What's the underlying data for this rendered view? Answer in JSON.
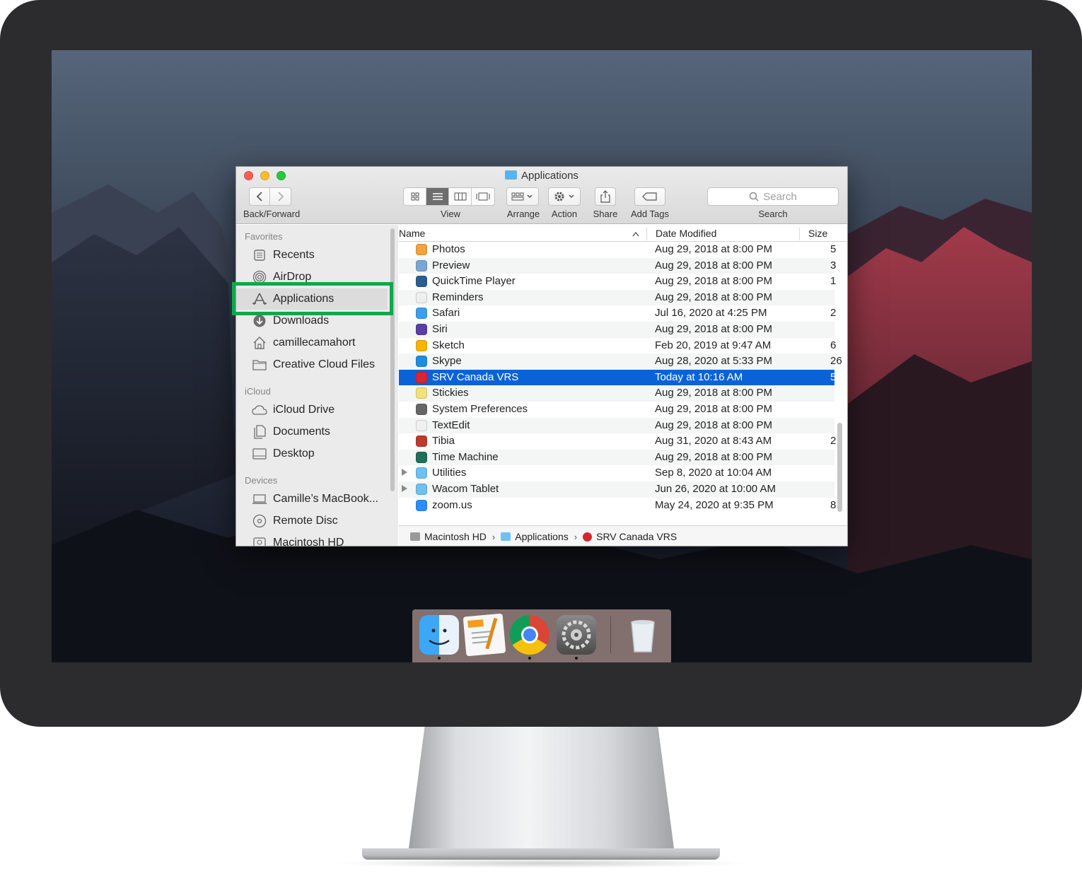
{
  "window": {
    "title": "Applications"
  },
  "toolbar": {
    "back_forward_label": "Back/Forward",
    "view_label": "View",
    "arrange_label": "Arrange",
    "action_label": "Action",
    "share_label": "Share",
    "add_tags_label": "Add Tags",
    "search_placeholder": "Search",
    "search_label": "Search"
  },
  "sidebar": {
    "sections": [
      {
        "heading": "Favorites"
      },
      {
        "heading": "iCloud"
      },
      {
        "heading": "Devices"
      }
    ],
    "items": [
      {
        "label": "Recents",
        "icon": "recents-icon"
      },
      {
        "label": "AirDrop",
        "icon": "airdrop-icon"
      },
      {
        "label": "Applications",
        "icon": "applications-icon",
        "selected": true
      },
      {
        "label": "Downloads",
        "icon": "downloads-icon"
      },
      {
        "label": "camillecamahort",
        "icon": "home-icon"
      },
      {
        "label": "Creative Cloud Files",
        "icon": "folder-icon"
      },
      {
        "label": "iCloud Drive",
        "icon": "cloud-icon"
      },
      {
        "label": "Documents",
        "icon": "documents-icon"
      },
      {
        "label": "Desktop",
        "icon": "desktop-icon"
      },
      {
        "label": "Camille’s MacBook...",
        "icon": "laptop-icon"
      },
      {
        "label": "Remote Disc",
        "icon": "disc-icon"
      },
      {
        "label": "Macintosh HD",
        "icon": "harddrive-icon"
      }
    ]
  },
  "list": {
    "columns": {
      "name": "Name",
      "date_modified": "Date Modified",
      "size": "Size"
    },
    "rows": [
      {
        "name": "Photos",
        "date": "Aug 29, 2018 at 8:00 PM",
        "size": "5",
        "color": "#f3a33b"
      },
      {
        "name": "Preview",
        "date": "Aug 29, 2018 at 8:00 PM",
        "size": "3",
        "color": "#7aa6d6"
      },
      {
        "name": "QuickTime Player",
        "date": "Aug 29, 2018 at 8:00 PM",
        "size": "1",
        "color": "#2c5d8f"
      },
      {
        "name": "Reminders",
        "date": "Aug 29, 2018 at 8:00 PM",
        "size": "",
        "color": "#eeeeee"
      },
      {
        "name": "Safari",
        "date": "Jul 16, 2020 at 4:25 PM",
        "size": "2",
        "color": "#3a9ff0"
      },
      {
        "name": "Siri",
        "date": "Aug 29, 2018 at 8:00 PM",
        "size": "",
        "color": "#5b3fa8"
      },
      {
        "name": "Sketch",
        "date": "Feb 20, 2019 at 9:47 AM",
        "size": "6",
        "color": "#f7b500"
      },
      {
        "name": "Skype",
        "date": "Aug 28, 2020 at 5:33 PM",
        "size": "26",
        "color": "#1e8de0"
      },
      {
        "name": "SRV Canada VRS",
        "date": "Today at 10:16 AM",
        "size": "5",
        "color": "#d7262f",
        "selected": true
      },
      {
        "name": "Stickies",
        "date": "Aug 29, 2018 at 8:00 PM",
        "size": "",
        "color": "#f2e27a"
      },
      {
        "name": "System Preferences",
        "date": "Aug 29, 2018 at 8:00 PM",
        "size": "",
        "color": "#666666"
      },
      {
        "name": "TextEdit",
        "date": "Aug 29, 2018 at 8:00 PM",
        "size": "",
        "color": "#f0f0f0"
      },
      {
        "name": "Tibia",
        "date": "Aug 31, 2020 at 8:43 AM",
        "size": "2",
        "color": "#c0392b"
      },
      {
        "name": "Time Machine",
        "date": "Aug 29, 2018 at 8:00 PM",
        "size": "",
        "color": "#1f6f5a"
      },
      {
        "name": "Utilities",
        "date": "Sep 8, 2020 at 10:04 AM",
        "size": "",
        "color": "#6cc2f2",
        "folder": true
      },
      {
        "name": "Wacom Tablet",
        "date": "Jun 26, 2020 at 10:00 AM",
        "size": "",
        "color": "#6cc2f2",
        "folder": true
      },
      {
        "name": "zoom.us",
        "date": "May 24, 2020 at 9:35 PM",
        "size": "8",
        "color": "#2d8cff"
      }
    ]
  },
  "pathbar": {
    "items": [
      "Macintosh HD",
      "Applications",
      "SRV Canada VRS"
    ]
  },
  "dock": {
    "apps": [
      {
        "name": "finder-icon",
        "running": true
      },
      {
        "name": "pages-icon",
        "running": false
      },
      {
        "name": "chrome-icon",
        "running": true
      },
      {
        "name": "system-preferences-icon",
        "running": true
      },
      {
        "name": "trash-icon",
        "running": false
      }
    ]
  },
  "colors": {
    "selection": "#0a63d6",
    "highlight_box": "#0fa84a"
  }
}
